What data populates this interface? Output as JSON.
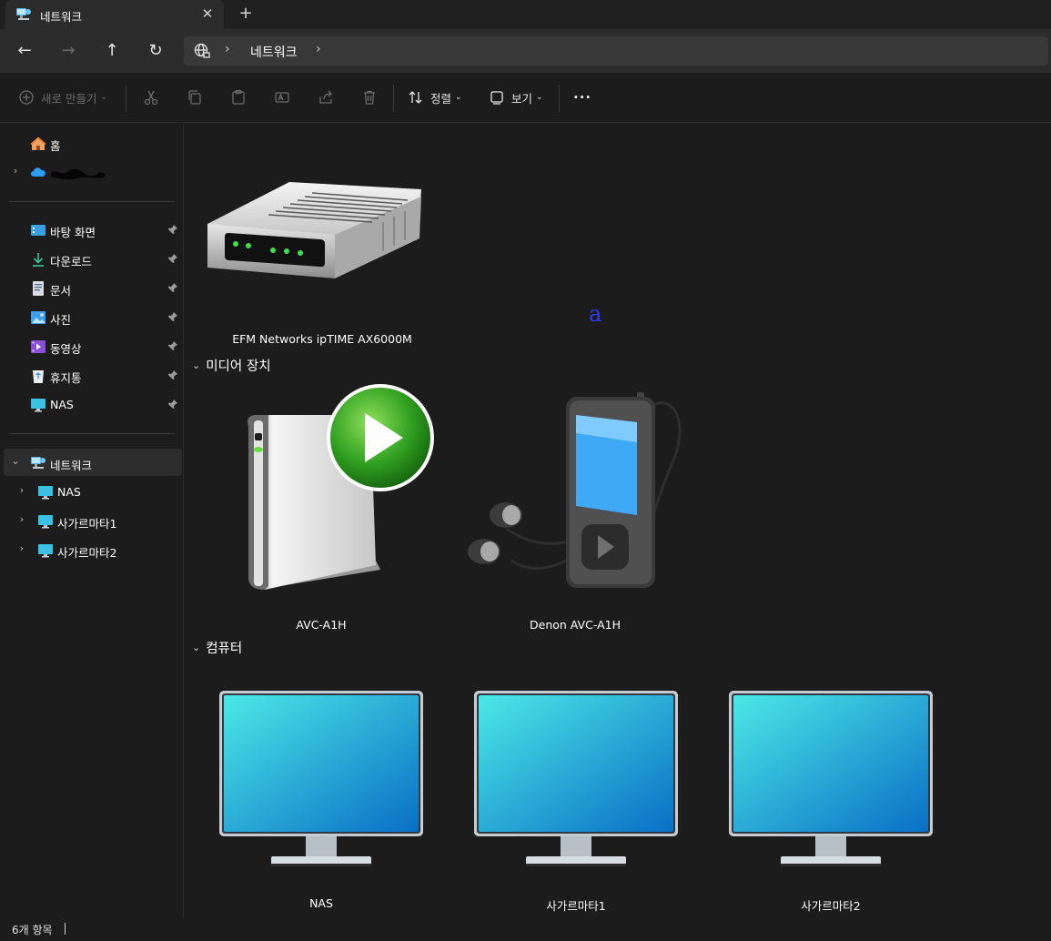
{
  "tab": {
    "title": "네트워크",
    "close_glyph": "✕",
    "new_tab_glyph": "+",
    "icon": "network-icon"
  },
  "nav": {
    "back": "←",
    "forward": "→",
    "up": "↑",
    "refresh": "↻"
  },
  "address": {
    "crumb": "네트워크",
    "separator": "›"
  },
  "commands": {
    "new_label": "새로 만들기",
    "sort_label": "정렬",
    "view_label": "보기",
    "more_glyph": "···"
  },
  "sidebar": {
    "home": "홈",
    "pinned": [
      {
        "label": "바탕 화면",
        "icon": "desktop-icon"
      },
      {
        "label": "다운로드",
        "icon": "download-icon"
      },
      {
        "label": "문서",
        "icon": "documents-icon"
      },
      {
        "label": "사진",
        "icon": "pictures-icon"
      },
      {
        "label": "동영상",
        "icon": "videos-icon"
      },
      {
        "label": "휴지통",
        "icon": "recycle-bin-icon"
      },
      {
        "label": "NAS",
        "icon": "computer-icon"
      }
    ],
    "network": {
      "label": "네트워크",
      "children": [
        "NAS",
        "사가르마타1",
        "사가르마타2"
      ]
    }
  },
  "content": {
    "network_devices": [
      {
        "label": "EFM Networks ipTIME AX6000M",
        "icon": "router-icon"
      }
    ],
    "stray_glyph": "a",
    "groups": [
      {
        "title": "미디어 장치",
        "items": [
          {
            "label": "AVC-A1H",
            "icon": "media-server-icon"
          },
          {
            "label": "Denon AVC-A1H",
            "icon": "media-player-icon"
          }
        ]
      },
      {
        "title": "컴퓨터",
        "items": [
          {
            "label": "NAS",
            "icon": "monitor-icon"
          },
          {
            "label": "사가르마타1",
            "icon": "monitor-icon"
          },
          {
            "label": "사가르마타2",
            "icon": "monitor-icon"
          }
        ]
      }
    ]
  },
  "status": {
    "item_count": "6개 항목"
  },
  "colors": {
    "background": "#1c1c1c",
    "tab_active": "#2c2c2c",
    "address_bg": "#383838",
    "selected": "#2d2d2d",
    "accent": "#4cc2ff"
  }
}
